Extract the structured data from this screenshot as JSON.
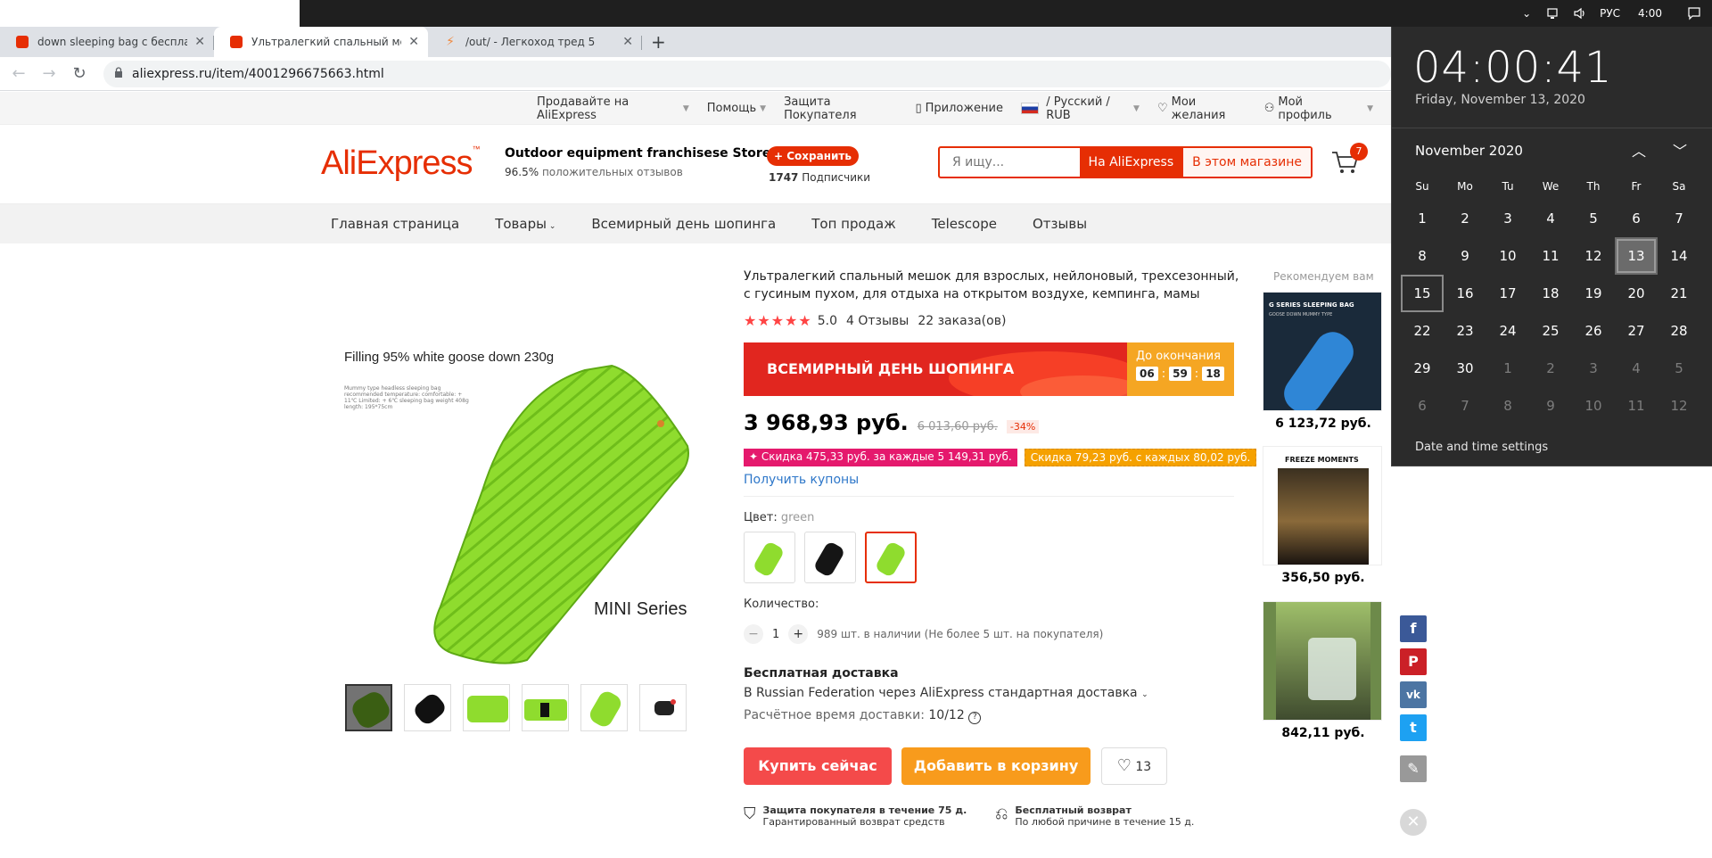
{
  "os": {
    "tray_lang": "РУС",
    "tray_time": "4:00",
    "icons": [
      "chevron-up-icon",
      "network-icon",
      "speaker-icon",
      "notification-icon"
    ]
  },
  "browser": {
    "tabs": [
      {
        "title": "down sleeping bag с бесплатной",
        "favicon": "aliexpress-icon"
      },
      {
        "title": "Ультралегкий спальный мешок",
        "favicon": "aliexpress-icon"
      },
      {
        "title": "/out/ - Легкоход тред 5",
        "favicon": "bolt-icon"
      }
    ],
    "url": "aliexpress.ru/item/4001296675663.html"
  },
  "toplinks": {
    "sell": "Продавайте на AliExpress",
    "help": "Помощь",
    "protection": "Защита Покупателя",
    "app": "Приложение",
    "locale": "/ Русский / RUB",
    "wishlist": "Мои желания",
    "profile": "Мой профиль"
  },
  "header": {
    "logo": "AliExpress",
    "store_name": "Outdoor equipment franchisese Store",
    "rating_pct": "96.5%",
    "rating_text": "положительных отзывов",
    "save_label": "+ Сохранить",
    "subs_count": "1747",
    "subs_label": "Подписчики",
    "search_placeholder": "Я ищу...",
    "search_ae": "На AliExpress",
    "search_store": "В этом магазине",
    "cart_count": "7"
  },
  "storenav": [
    "Главная страница",
    "Товары",
    "Всемирный день шопинга",
    "Топ продаж",
    "Telescope",
    "Отзывы"
  ],
  "gallery": {
    "caption": "Filling 95% white goose down 230g",
    "tiny": "Mummy type headless sleeping bag recommended temperature: comfortable: + 11℃ Limited: + 6℃ sleeping bag weight 408g length: 195*75cm",
    "series": "MINI Series"
  },
  "product": {
    "title": "Ультралегкий спальный мешок для взрослых, нейлоновый, трехсезонный, с гусиным пухом, для отдыха на открытом воздухе, кемпинга, мамы",
    "rating": "5.0",
    "reviews": "4 Отзывы",
    "orders": "22 заказа(ов)",
    "banner": "ВСЕМИРНЫЙ ДЕНЬ ШОПИНГА",
    "countdown_label": "До окончания",
    "countdown": [
      "06",
      "59",
      "18"
    ],
    "price": "3 968,93 руб.",
    "old_price": "6 013,60 руб.",
    "discount": "-34%",
    "coupon1": "✦ Скидка 475,33 руб. за каждые 5 149,31 руб.",
    "coupon2": "Скидка 79,23 руб. с каждых 80,02 руб.",
    "get_coupons": "Получить купоны",
    "color_label": "Цвет:",
    "color_value": "green",
    "qty_label": "Количество:",
    "qty": "1",
    "stock": "989 шт. в наличии (Не более 5 шт. на покупателя)",
    "ship_title": "Бесплатная доставка",
    "ship_via": "В Russian Federation через AliExpress стандартная доставка",
    "ship_eta_label": "Расчётное время доставки:",
    "ship_eta": "10/12",
    "buy": "Купить сейчас",
    "add_cart": "Добавить в корзину",
    "wish_count": "13",
    "g1_title": "Защита покупателя в течение 75 д.",
    "g1_text": "Гарантированный возврат средств",
    "g2_title": "Бесплатный возврат",
    "g2_text": "По любой причине в течение 15 д."
  },
  "recommended": {
    "title": "Рекомендуем вам",
    "items": [
      {
        "price": "6 123,72 руб.",
        "img_text": "G SERIES SLEEPING BAG",
        "img_sub": "GOOSE DOWN MUMMY TYPE"
      },
      {
        "price": "356,50 руб.",
        "img_text": "FREEZE MOMENTS"
      },
      {
        "price": "842,11 руб."
      }
    ]
  },
  "share": [
    "facebook-icon",
    "pinterest-icon",
    "vk-icon",
    "twitter-icon",
    "edit-icon"
  ],
  "calendar": {
    "time": "04:00:41",
    "date": "Friday, November 13, 2020",
    "month": "November 2020",
    "dow": [
      "Su",
      "Mo",
      "Tu",
      "We",
      "Th",
      "Fr",
      "Sa"
    ],
    "days": [
      "1",
      "2",
      "3",
      "4",
      "5",
      "6",
      "7",
      "8",
      "9",
      "10",
      "11",
      "12",
      "13",
      "14",
      "15",
      "16",
      "17",
      "18",
      "19",
      "20",
      "21",
      "22",
      "23",
      "24",
      "25",
      "26",
      "27",
      "28",
      "29",
      "30",
      "1",
      "2",
      "3",
      "4",
      "5",
      "6",
      "7",
      "8",
      "9",
      "10",
      "11",
      "12"
    ],
    "today": "13",
    "settings": "Date and time settings"
  }
}
